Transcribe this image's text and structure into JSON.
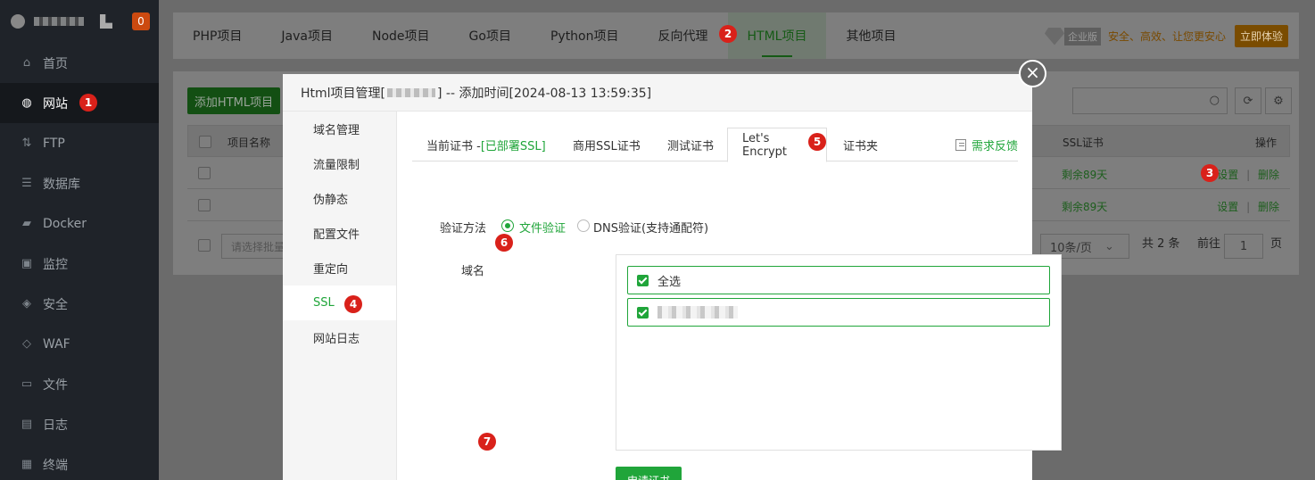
{
  "sidebar": {
    "unread_count": "0",
    "items": [
      {
        "label": "首页",
        "icon": "home-icon",
        "glyph": "⌂"
      },
      {
        "label": "网站",
        "icon": "globe-icon",
        "glyph": "◍"
      },
      {
        "label": "FTP",
        "icon": "ftp-icon",
        "glyph": "⇅"
      },
      {
        "label": "数据库",
        "icon": "database-icon",
        "glyph": "☰"
      },
      {
        "label": "Docker",
        "icon": "docker-icon",
        "glyph": "▰"
      },
      {
        "label": "监控",
        "icon": "monitor-icon",
        "glyph": "▣"
      },
      {
        "label": "安全",
        "icon": "shield-icon",
        "glyph": "◈"
      },
      {
        "label": "WAF",
        "icon": "waf-icon",
        "glyph": "◇"
      },
      {
        "label": "文件",
        "icon": "folder-icon",
        "glyph": "▭"
      },
      {
        "label": "日志",
        "icon": "log-icon",
        "glyph": "▤"
      },
      {
        "label": "终端",
        "icon": "terminal-icon",
        "glyph": "▦"
      }
    ]
  },
  "project_tabs": [
    "PHP项目",
    "Java项目",
    "Node项目",
    "Go项目",
    "Python项目",
    "反向代理",
    "HTML项目",
    "其他项目"
  ],
  "promo": {
    "badge": "企业版",
    "text": "安全、高效、让您更安心",
    "button": "立即体验"
  },
  "panel": {
    "add_button": "添加HTML项目",
    "col_name": "项目名称",
    "col_ssl": "SSL证书",
    "col_ops": "操作",
    "rows": [
      {
        "ssl": "剩余89天",
        "settings": "设置",
        "delete": "删除",
        "sep": "|"
      },
      {
        "ssl": "剩余89天",
        "settings": "设置",
        "delete": "删除",
        "sep": "|"
      }
    ],
    "batch_placeholder": "请选择批量",
    "page_size": "10条/页",
    "total": "共 2 条",
    "goto": "前往",
    "page": "1",
    "page_suffix": "页"
  },
  "modal": {
    "title_prefix": "Html项目管理[",
    "title_suffix": "] -- 添加时间[2024-08-13 13:59:35]",
    "nav": [
      "域名管理",
      "流量限制",
      "伪静态",
      "配置文件",
      "重定向",
      "SSL",
      "网站日志"
    ],
    "ssl_tabs": [
      "当前证书 -",
      "[已部署SSL]",
      "商用SSL证书",
      "测试证书",
      "Let's Encrypt",
      "证书夹"
    ],
    "feedback": "需求反馈",
    "verify_label": "验证方法",
    "verify_file": "文件验证",
    "verify_dns": "DNS验证(支持通配符)",
    "domain_label": "域名",
    "select_all": "全选",
    "apply_button": "申请证书"
  },
  "markers": [
    "1",
    "2",
    "3",
    "4",
    "5",
    "6",
    "7"
  ],
  "colors": {
    "accent": "#20a53a",
    "marker": "#d9211a",
    "sidebar_bg": "#1f2329"
  }
}
